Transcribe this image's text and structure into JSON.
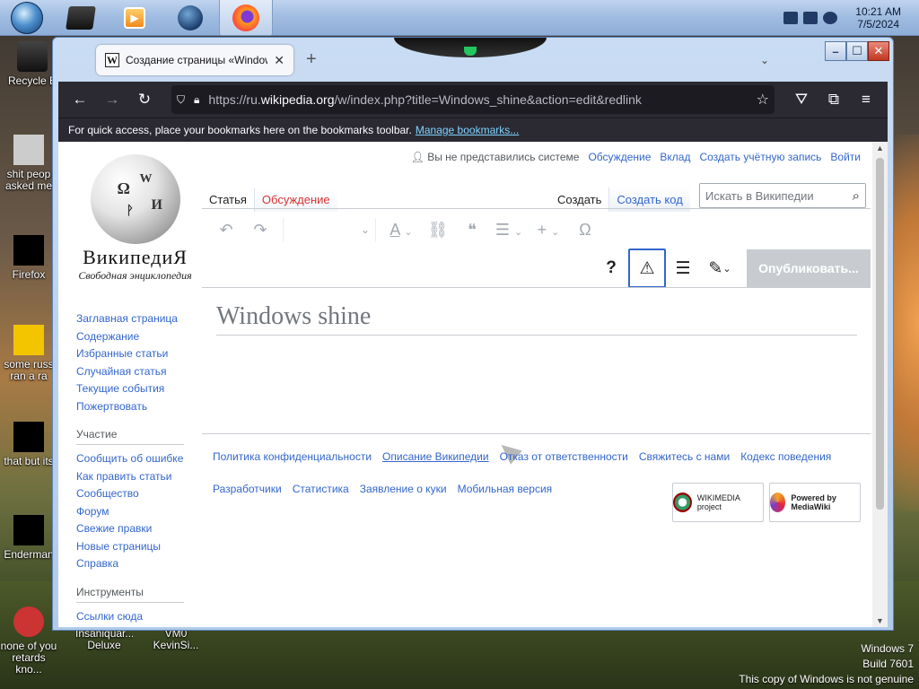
{
  "taskbar": {
    "clock_time": "10:21 AM",
    "clock_date": "7/5/2024"
  },
  "desktop_icons": [
    {
      "label": "Recycle B"
    },
    {
      "label": "shit peop asked me"
    },
    {
      "label": "Firefox"
    },
    {
      "label": "some russ ran a ra"
    },
    {
      "label": "that but its"
    },
    {
      "label": "Enderman"
    },
    {
      "label": "none of you retards kno..."
    },
    {
      "label": "Insaniquar... Deluxe"
    },
    {
      "label": "VM0 KevinSi..."
    }
  ],
  "watermark": {
    "line1": "Windows 7",
    "line2": "Build 7601",
    "line3": "This copy of Windows is not genuine"
  },
  "browser": {
    "tab_title": "Создание страницы «Window",
    "tab_favicon": "W",
    "url_prefix": "https://ru.",
    "url_domain": "wikipedia.org",
    "url_rest": "/w/index.php?title=Windows_shine&action=edit&redlink",
    "bookmark_hint": "For quick access, place your bookmarks here on the bookmarks toolbar.",
    "manage_bookmarks": "Manage bookmarks..."
  },
  "wiki": {
    "logo_title": "ВикипедиЯ",
    "logo_subtitle": "Свободная энциклопедия",
    "nav_links": [
      "Заглавная страница",
      "Содержание",
      "Избранные статьи",
      "Случайная статья",
      "Текущие события",
      "Пожертвовать"
    ],
    "participation_header": "Участие",
    "participation_links": [
      "Сообщить об ошибке",
      "Как править статьи",
      "Сообщество",
      "Форум",
      "Свежие правки",
      "Новые страницы",
      "Справка"
    ],
    "tools_header": "Инструменты",
    "tools_links": [
      "Ссылки сюда"
    ],
    "user": {
      "anon": "Вы не представились системе",
      "talk": "Обсуждение",
      "contrib": "Вклад",
      "create_account": "Создать учётную запись",
      "login": "Войти"
    },
    "tabs": {
      "article": "Статья",
      "discussion": "Обсуждение",
      "create": "Создать",
      "create_code": "Создать код"
    },
    "search_placeholder": "Искать в Википедии",
    "publish": "Опубликовать...",
    "page_title": "Windows shine",
    "footer_row1": [
      "Политика конфиденциальности",
      "Описание Википедии",
      "Отказ от ответственности",
      "Свяжитесь с нами",
      "Кодекс поведения"
    ],
    "footer_row2": [
      "Разработчики",
      "Статистика",
      "Заявление о куки",
      "Мобильная версия"
    ],
    "badge_wikimedia": "WIKIMEDIA project",
    "badge_mediawiki": "Powered by MediaWiki"
  },
  "colors": {
    "link": "#3366cc",
    "redlink": "#d73333",
    "browser_dark": "#2b2a33",
    "taskbar": "#9fbbe0"
  }
}
